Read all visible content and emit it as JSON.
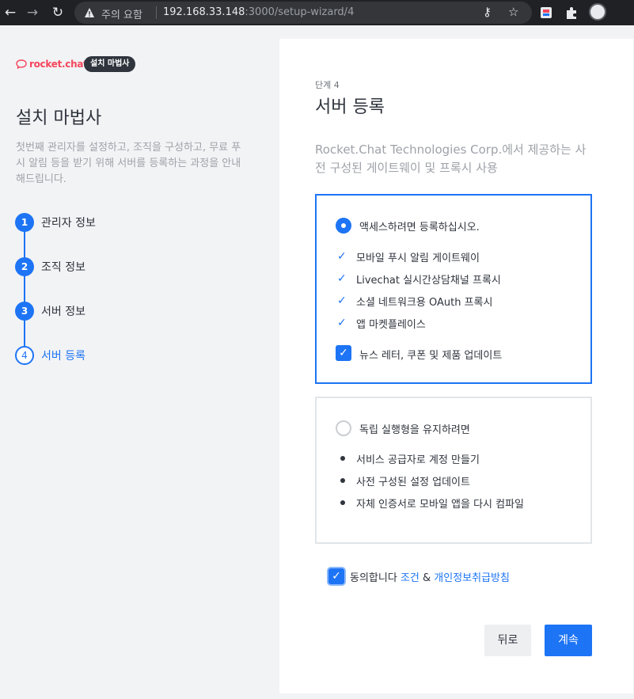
{
  "browser": {
    "back_icon": "back-arrow-icon",
    "forward_icon": "forward-arrow-icon",
    "reload_icon": "reload-icon",
    "warning_text": "주의 요함",
    "url_host": "192.168.33.148",
    "url_path": ":3000/setup-wizard/4"
  },
  "brand": {
    "logo_text": "rocket.chat",
    "badge": "설치 마법사",
    "brand_color": "#f5455c"
  },
  "left": {
    "title": "설치 마법사",
    "description": "첫번째 관리자를 설정하고, 조직을 구성하고, 무료 푸시 알림 등을 받기 위해 서버를 등록하는 과정을 안내해드립니다.",
    "steps": [
      {
        "number": "1",
        "label": "관리자 정보"
      },
      {
        "number": "2",
        "label": "조직 정보"
      },
      {
        "number": "3",
        "label": "서버 정보"
      },
      {
        "number": "4",
        "label": "서버 등록"
      }
    ],
    "current_step": 4
  },
  "card": {
    "step_label": "단계 4",
    "title": "서버 등록",
    "subtitle": "Rocket.Chat Technologies Corp.에서 제공하는 사전 구성된 게이트웨이 및 프록시 사용",
    "option_register": {
      "title": "액세스하려면 등록하십시오.",
      "selected": true,
      "features": [
        "모바일 푸시 알림 게이트웨이",
        "Livechat 실시간상담채널 프록시",
        "소셜 네트워크용 OAuth 프록시",
        "앱 마켓플레이스"
      ],
      "newsletter_label": "뉴스 레터, 쿠폰 및 제품 업데이트",
      "newsletter_checked": true
    },
    "option_standalone": {
      "title": "독립 실행형을 유지하려면",
      "selected": false,
      "features": [
        "서비스 공급자로 계정 만들기",
        "사전 구성된 설정 업데이트",
        "자체 인증서로 모바일 앱을 다시 컴파일"
      ]
    },
    "agree": {
      "prefix": "동의합니다",
      "terms_link": "조건",
      "amp": "&",
      "privacy_link": "개인정보취급방침",
      "checked": true
    },
    "back_button": "뒤로",
    "continue_button": "계속"
  },
  "colors": {
    "accent": "#1d74f5",
    "text": "#2f343d",
    "muted": "#9ea2a8"
  }
}
